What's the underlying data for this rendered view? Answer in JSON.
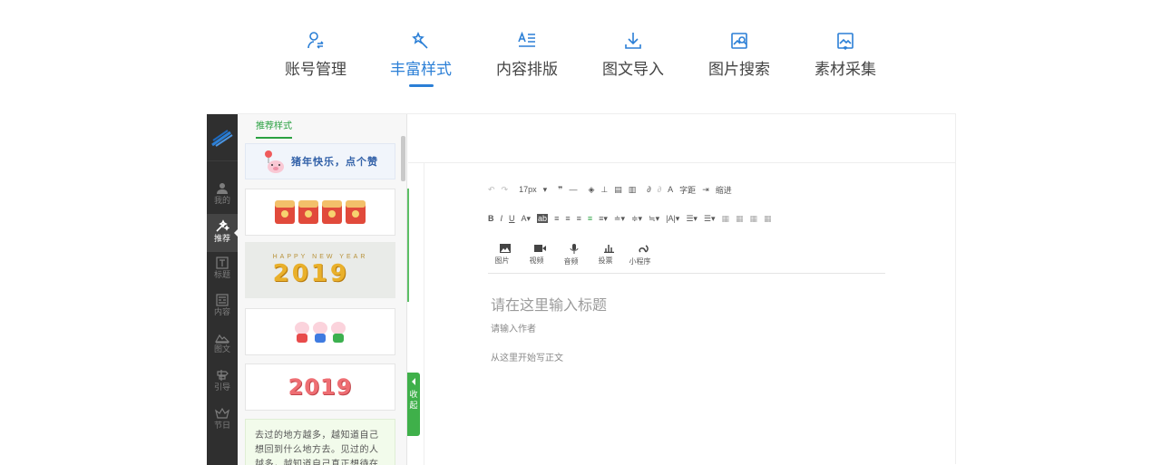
{
  "topnav": {
    "items": [
      {
        "label": "账号管理",
        "icon": "account-manage-icon"
      },
      {
        "label": "丰富样式",
        "icon": "magic-wand-icon",
        "active": true
      },
      {
        "label": "内容排版",
        "icon": "typeset-icon"
      },
      {
        "label": "图文导入",
        "icon": "download-icon"
      },
      {
        "label": "图片搜索",
        "icon": "image-search-icon"
      },
      {
        "label": "素材采集",
        "icon": "material-collect-icon"
      }
    ],
    "accent": "#2b7fd6"
  },
  "sidebar": {
    "items": [
      {
        "label": "我的",
        "icon": "user-icon"
      },
      {
        "label": "推荐",
        "icon": "wand-icon",
        "active": true
      },
      {
        "label": "标题",
        "icon": "title-icon"
      },
      {
        "label": "内容",
        "icon": "content-icon"
      },
      {
        "label": "图文",
        "icon": "image-text-icon"
      },
      {
        "label": "引导",
        "icon": "signpost-icon"
      },
      {
        "label": "节日",
        "icon": "crown-icon"
      }
    ]
  },
  "panel": {
    "tab": "推荐样式",
    "cards": {
      "banner_text": "猪年快乐，点个赞",
      "gold_sub": "HAPPY NEW YEAR",
      "gold_year": "2019",
      "red_year": "2019",
      "text_snippet": "去过的地方越多，越知道自己想回到什么地方去。见过的人越多，越知道自己真正想待在"
    },
    "collapse_label_1": "收",
    "collapse_label_2": "起",
    "accent": "#2aa141"
  },
  "editor": {
    "font_size": "17px",
    "letter_spacing_label": "字距",
    "indent_label": "缩进",
    "insert": [
      "图片",
      "视频",
      "音频",
      "投票",
      "小程序"
    ],
    "title_placeholder": "请在这里输入标题",
    "author_placeholder": "请输入作者",
    "body_placeholder": "从这里开始写正文"
  }
}
